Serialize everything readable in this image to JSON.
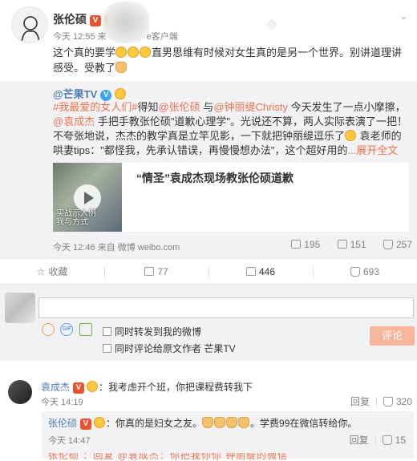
{
  "post": {
    "author": "张伦硕",
    "time_prefix": "今天 12:55 来",
    "time_suffix": "e客户端",
    "text_a": "这个真的要学",
    "text_b": "直男思维有时候对女生真的是另一个世界。别讲道理讲感受。受教了"
  },
  "repost": {
    "author": "@芒果TV",
    "hashtag1": "#我最爱的女人们#",
    "t1": "得知",
    "mention1": "@张伦硕",
    "t2": " 与",
    "mention2": "@钟丽缇Christy",
    "t3": " 今天发生了一点小摩擦，",
    "mention3": "@袁成杰",
    "t4": " 手把手教张伦硕\"道歉心理学\"。光说还不算，两人实际表演了一把！不夸张地说，杰杰的教学真是立竿见影，一下就把钟丽缇逗乐了",
    "t5": " 袁老师的哄妻tips：\"都怪我，先承认错误，再慢慢想办法\"，这个超好用的",
    "more": "...展开全文",
    "video_title": "“情圣”袁成杰现场教张伦硕道歉",
    "video_caption": "实战示人例\n我与方式",
    "meta": "今天 12:46 来自 微博 weibo.com",
    "shares": "195",
    "comments": "151",
    "likes": "257"
  },
  "actions": {
    "favorite": "收藏",
    "repost": "77",
    "comment": "446",
    "like": "693"
  },
  "composer": {
    "option1": "同时转发到我的微博",
    "option2": "同时评论给原文作者 芒果TV",
    "submit": "评论"
  },
  "comment1": {
    "author": "袁成杰",
    "text": "：我考虑开个班，你把课程费转我下",
    "time": "今天 14:19",
    "reply_label": "回复",
    "likes": "320"
  },
  "reply1": {
    "author": "张伦硕",
    "text_a": "：你真的是妇女之友。",
    "text_b": "。学费99在微信转给你。",
    "time": "今天 14:47",
    "reply_label": "回复",
    "likes": "15",
    "cut_text": "张伦硕   ：回复 @袁成杰：你把我你你   钟丽缇的微信"
  },
  "colors": {
    "link": "#eb7350",
    "repost_bg": "#f2f2f5",
    "submit_bg": "#f7b59b"
  }
}
